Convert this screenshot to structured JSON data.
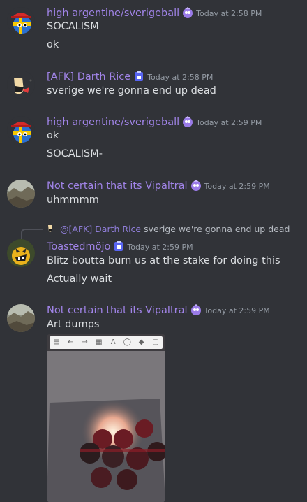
{
  "messages": [
    {
      "author": "high argentine/sverigeball",
      "timestamp": "Today at 2:58 PM",
      "lines": [
        "SOCALISM",
        "ok"
      ],
      "avatar": "sweden-ball-icon",
      "badge": "nitro-badge-icon"
    },
    {
      "author": "[AFK] Darth Rice",
      "timestamp": "Today at 2:58 PM",
      "lines": [
        "sverige we're gonna end up dead"
      ],
      "avatar": "rice-character-icon",
      "badge": "boost-badge-icon"
    },
    {
      "author": "high argentine/sverigeball",
      "timestamp": "Today at 2:59 PM",
      "lines": [
        "ok",
        "SOCALISM-"
      ],
      "avatar": "sweden-ball-icon",
      "badge": "nitro-badge-icon"
    },
    {
      "author": "Not certain that its Vipaltral",
      "timestamp": "Today at 2:59 PM",
      "lines": [
        "uhmmmm"
      ],
      "avatar": "landscape-photo-icon",
      "badge": "nitro-badge-icon"
    },
    {
      "reply_to": {
        "author": "@[AFK] Darth Rice",
        "text": "sverige we're gonna end up dead"
      },
      "author": "Toastedmöjo",
      "timestamp": "Today at 2:59 PM",
      "lines": [
        "Blïtz boutta burn us at the stake for doing this",
        "Actually wait"
      ],
      "avatar": "yellow-creature-icon",
      "badge": "boost-badge-icon"
    },
    {
      "author": "Not certain that its Vipaltral",
      "timestamp": "Today at 2:59 PM",
      "lines": [
        "Art dumps"
      ],
      "avatar": "landscape-photo-icon",
      "badge": "nitro-badge-icon",
      "attachment": {
        "kind": "image",
        "description_icon": "art-dump-image",
        "toolbar_icons": [
          "layers-icon",
          "undo-icon",
          "redo-icon",
          "grid-icon",
          "text-icon",
          "color-wheel-icon",
          "stack-icon",
          "fullscreen-icon"
        ]
      }
    }
  ],
  "colors": {
    "background": "#313338",
    "username": "#a184e8",
    "timestamp": "#949ba4",
    "text": "#dbdee1"
  }
}
